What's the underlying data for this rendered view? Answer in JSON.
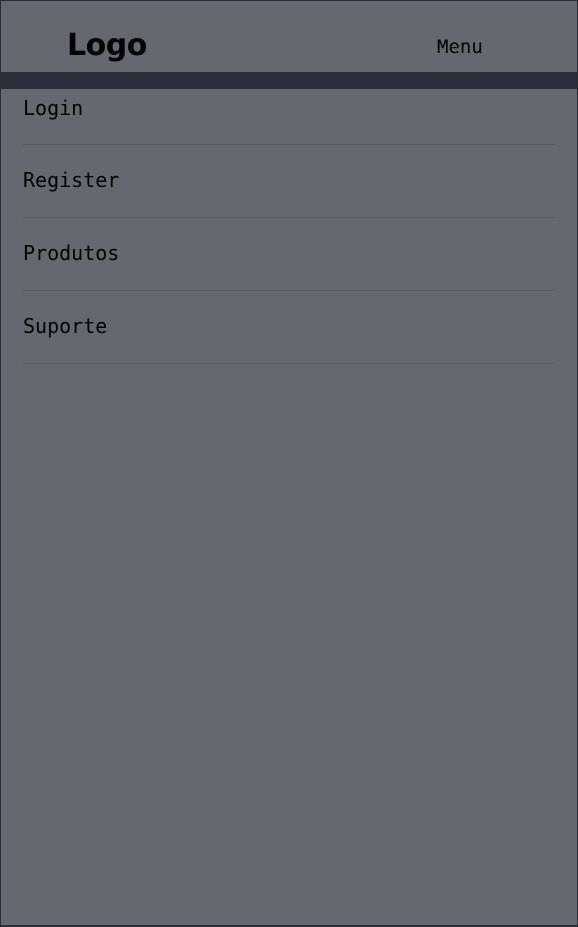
{
  "header": {
    "logo_text": "Logo",
    "menu_label": "Menu"
  },
  "nav": {
    "items": [
      {
        "label": "Login"
      },
      {
        "label": "Register"
      },
      {
        "label": "Produtos"
      },
      {
        "label": "Suporte"
      }
    ]
  },
  "colors": {
    "background": "#676770",
    "header_band": "#2d2d3b",
    "text": "#000000",
    "divider": "#5b5b64"
  }
}
